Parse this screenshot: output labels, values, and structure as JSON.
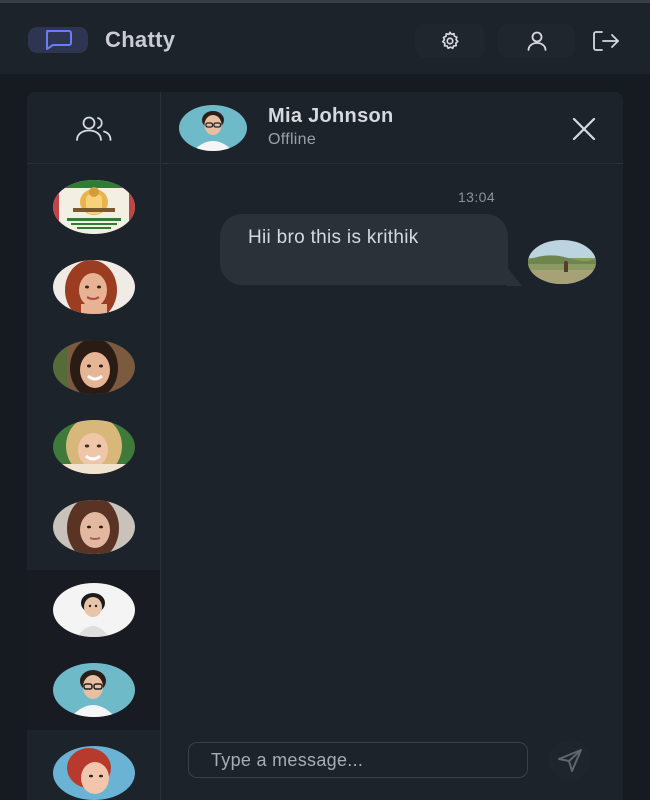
{
  "app": {
    "title": "Chatty",
    "logo_icon": "message-square-icon"
  },
  "header_actions": [
    {
      "name": "settings",
      "icon": "gear-icon"
    },
    {
      "name": "profile",
      "icon": "user-icon"
    },
    {
      "name": "logout",
      "icon": "logout-icon"
    }
  ],
  "sidebar": {
    "header_icon": "users-icon",
    "contacts": [
      {
        "avatar": "avatar-saraswati",
        "active": false
      },
      {
        "avatar": "avatar-woman-red-hair",
        "active": false
      },
      {
        "avatar": "avatar-woman-smiling",
        "active": false
      },
      {
        "avatar": "avatar-woman-blonde",
        "active": false
      },
      {
        "avatar": "avatar-woman-brown-hair",
        "active": false
      },
      {
        "avatar": "avatar-person-white-background",
        "active": true
      },
      {
        "avatar": "avatar-mia-johnson",
        "active": true
      },
      {
        "avatar": "avatar-woman-red-hair-2",
        "active": false
      }
    ]
  },
  "chat": {
    "contact_name": "Mia Johnson",
    "status": "Offline",
    "messages": [
      {
        "time": "13:04",
        "text": "Hii bro this is krithik",
        "sender_avatar": "avatar-landscape"
      }
    ],
    "input": {
      "placeholder": "Type a message...",
      "value": ""
    },
    "send_icon": "send-icon"
  },
  "colors": {
    "accent": "#6b7bff",
    "background": "#161b22",
    "panel": "#1d232b",
    "bubble": "#2b3139"
  }
}
